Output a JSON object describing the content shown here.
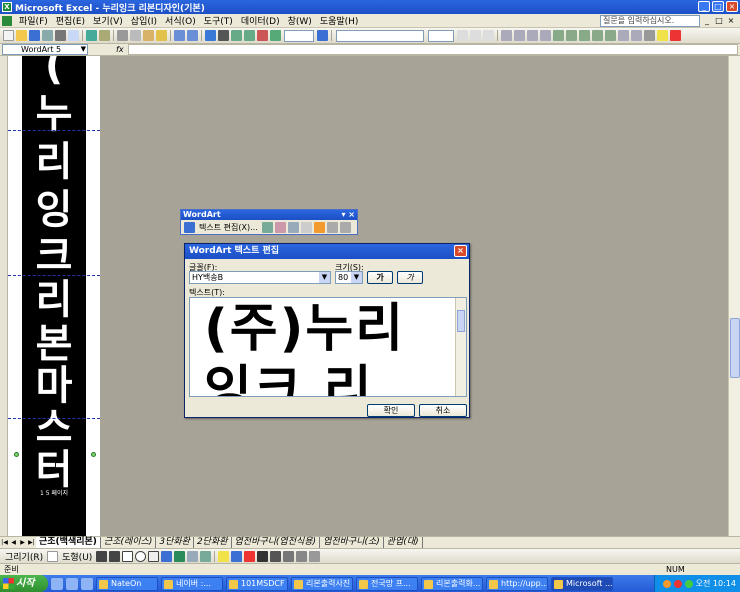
{
  "window": {
    "title": "Microsoft Excel - 누리잉크 리본디자인(기본)"
  },
  "menu": {
    "items": [
      "파일(F)",
      "편집(E)",
      "보기(V)",
      "삽입(I)",
      "서식(O)",
      "도구(T)",
      "데이터(D)",
      "창(W)",
      "도움말(H)"
    ],
    "help_placeholder": "질문을 입력하십시오."
  },
  "formula": {
    "name_box": "WordArt 5",
    "fx": "fx"
  },
  "ribbon": {
    "chars": [
      "(",
      "누",
      "리",
      "잉",
      "크",
      "리",
      "본",
      "마",
      "스",
      "터"
    ],
    "footer": "1 5 페이지"
  },
  "wordart_toolbar": {
    "title": "WordArt",
    "edit_label": "텍스트 편집(X)..."
  },
  "dialog": {
    "title": "WordArt 텍스트 편집",
    "font_label": "글꼴(F):",
    "font_value": "HY백송B",
    "size_label": "크기(S):",
    "size_value": "80",
    "bold_label": "가",
    "italic_label": "가",
    "text_label": "텍스트(T):",
    "text_value": "(주)누리\n잉크 리",
    "ok_label": "확인",
    "cancel_label": "취소"
  },
  "sheet_tabs": [
    "근조(백색리본)",
    "근조(레이스)",
    "3단화환",
    "2단화환",
    "엽전바구니(엽전식용)",
    "엽전바구니(소)",
    "관엽(대)"
  ],
  "active_tab_index": 0,
  "drawing_toolbar": {
    "draw_label": "그리기(R)",
    "autoshape_label": "도형(U)"
  },
  "status": {
    "ready": "준비",
    "num": "NUM"
  },
  "taskbar": {
    "start_label": "시작",
    "buttons": [
      "NateOn",
      "네이버 :...",
      "101MSDCF",
      "리본출력사진",
      "전국망 프...",
      "리본출력화...",
      "http://upp...",
      "Microsoft ..."
    ],
    "active_index": 7,
    "clock": "오전 10:14"
  },
  "colors": {
    "title_blue": "#1c4fc5",
    "workspace_gray": "#a7a497",
    "close_red": "#d94a2a"
  }
}
